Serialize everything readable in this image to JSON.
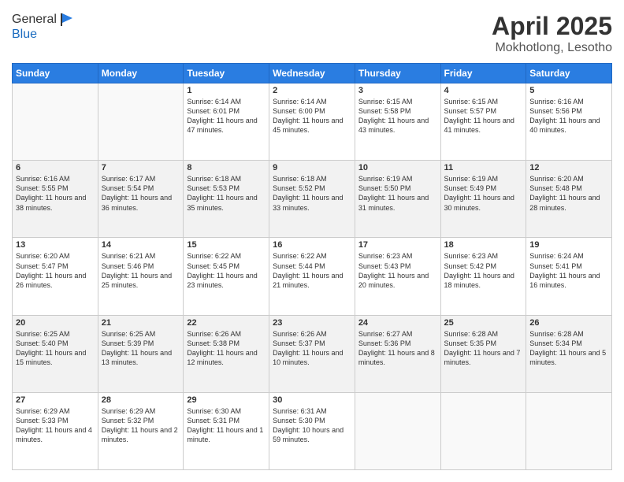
{
  "header": {
    "logo_line1": "General",
    "logo_line2": "Blue",
    "title": "April 2025",
    "location": "Mokhotlong, Lesotho"
  },
  "days_of_week": [
    "Sunday",
    "Monday",
    "Tuesday",
    "Wednesday",
    "Thursday",
    "Friday",
    "Saturday"
  ],
  "weeks": [
    [
      {
        "num": "",
        "info": ""
      },
      {
        "num": "",
        "info": ""
      },
      {
        "num": "1",
        "info": "Sunrise: 6:14 AM\nSunset: 6:01 PM\nDaylight: 11 hours and 47 minutes."
      },
      {
        "num": "2",
        "info": "Sunrise: 6:14 AM\nSunset: 6:00 PM\nDaylight: 11 hours and 45 minutes."
      },
      {
        "num": "3",
        "info": "Sunrise: 6:15 AM\nSunset: 5:58 PM\nDaylight: 11 hours and 43 minutes."
      },
      {
        "num": "4",
        "info": "Sunrise: 6:15 AM\nSunset: 5:57 PM\nDaylight: 11 hours and 41 minutes."
      },
      {
        "num": "5",
        "info": "Sunrise: 6:16 AM\nSunset: 5:56 PM\nDaylight: 11 hours and 40 minutes."
      }
    ],
    [
      {
        "num": "6",
        "info": "Sunrise: 6:16 AM\nSunset: 5:55 PM\nDaylight: 11 hours and 38 minutes."
      },
      {
        "num": "7",
        "info": "Sunrise: 6:17 AM\nSunset: 5:54 PM\nDaylight: 11 hours and 36 minutes."
      },
      {
        "num": "8",
        "info": "Sunrise: 6:18 AM\nSunset: 5:53 PM\nDaylight: 11 hours and 35 minutes."
      },
      {
        "num": "9",
        "info": "Sunrise: 6:18 AM\nSunset: 5:52 PM\nDaylight: 11 hours and 33 minutes."
      },
      {
        "num": "10",
        "info": "Sunrise: 6:19 AM\nSunset: 5:50 PM\nDaylight: 11 hours and 31 minutes."
      },
      {
        "num": "11",
        "info": "Sunrise: 6:19 AM\nSunset: 5:49 PM\nDaylight: 11 hours and 30 minutes."
      },
      {
        "num": "12",
        "info": "Sunrise: 6:20 AM\nSunset: 5:48 PM\nDaylight: 11 hours and 28 minutes."
      }
    ],
    [
      {
        "num": "13",
        "info": "Sunrise: 6:20 AM\nSunset: 5:47 PM\nDaylight: 11 hours and 26 minutes."
      },
      {
        "num": "14",
        "info": "Sunrise: 6:21 AM\nSunset: 5:46 PM\nDaylight: 11 hours and 25 minutes."
      },
      {
        "num": "15",
        "info": "Sunrise: 6:22 AM\nSunset: 5:45 PM\nDaylight: 11 hours and 23 minutes."
      },
      {
        "num": "16",
        "info": "Sunrise: 6:22 AM\nSunset: 5:44 PM\nDaylight: 11 hours and 21 minutes."
      },
      {
        "num": "17",
        "info": "Sunrise: 6:23 AM\nSunset: 5:43 PM\nDaylight: 11 hours and 20 minutes."
      },
      {
        "num": "18",
        "info": "Sunrise: 6:23 AM\nSunset: 5:42 PM\nDaylight: 11 hours and 18 minutes."
      },
      {
        "num": "19",
        "info": "Sunrise: 6:24 AM\nSunset: 5:41 PM\nDaylight: 11 hours and 16 minutes."
      }
    ],
    [
      {
        "num": "20",
        "info": "Sunrise: 6:25 AM\nSunset: 5:40 PM\nDaylight: 11 hours and 15 minutes."
      },
      {
        "num": "21",
        "info": "Sunrise: 6:25 AM\nSunset: 5:39 PM\nDaylight: 11 hours and 13 minutes."
      },
      {
        "num": "22",
        "info": "Sunrise: 6:26 AM\nSunset: 5:38 PM\nDaylight: 11 hours and 12 minutes."
      },
      {
        "num": "23",
        "info": "Sunrise: 6:26 AM\nSunset: 5:37 PM\nDaylight: 11 hours and 10 minutes."
      },
      {
        "num": "24",
        "info": "Sunrise: 6:27 AM\nSunset: 5:36 PM\nDaylight: 11 hours and 8 minutes."
      },
      {
        "num": "25",
        "info": "Sunrise: 6:28 AM\nSunset: 5:35 PM\nDaylight: 11 hours and 7 minutes."
      },
      {
        "num": "26",
        "info": "Sunrise: 6:28 AM\nSunset: 5:34 PM\nDaylight: 11 hours and 5 minutes."
      }
    ],
    [
      {
        "num": "27",
        "info": "Sunrise: 6:29 AM\nSunset: 5:33 PM\nDaylight: 11 hours and 4 minutes."
      },
      {
        "num": "28",
        "info": "Sunrise: 6:29 AM\nSunset: 5:32 PM\nDaylight: 11 hours and 2 minutes."
      },
      {
        "num": "29",
        "info": "Sunrise: 6:30 AM\nSunset: 5:31 PM\nDaylight: 11 hours and 1 minute."
      },
      {
        "num": "30",
        "info": "Sunrise: 6:31 AM\nSunset: 5:30 PM\nDaylight: 10 hours and 59 minutes."
      },
      {
        "num": "",
        "info": ""
      },
      {
        "num": "",
        "info": ""
      },
      {
        "num": "",
        "info": ""
      }
    ]
  ],
  "row_classes": [
    "row-light",
    "row-gray",
    "row-light",
    "row-gray",
    "row-light"
  ]
}
